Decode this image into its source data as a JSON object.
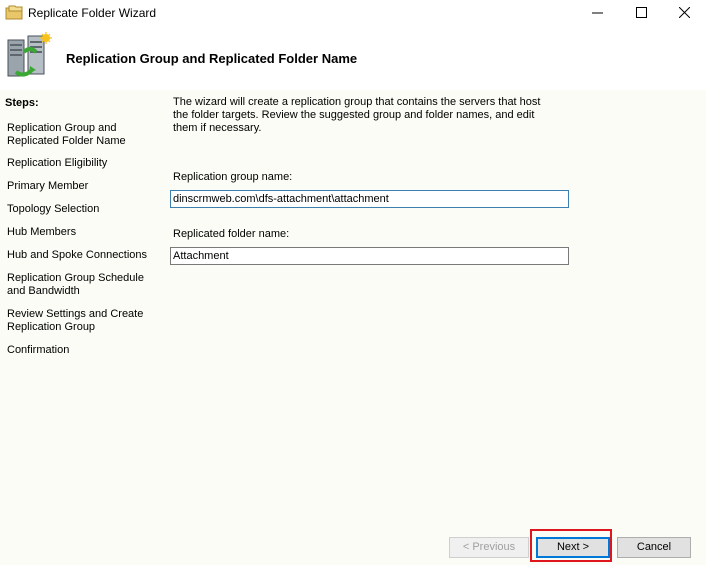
{
  "window": {
    "title": "Replicate Folder Wizard"
  },
  "header": {
    "title": "Replication Group and Replicated Folder Name"
  },
  "steps": {
    "heading": "Steps:",
    "items": [
      "Replication Group and Replicated Folder Name",
      "Replication Eligibility",
      "Primary Member",
      "Topology Selection",
      "Hub Members",
      "Hub and Spoke Connections",
      "Replication Group Schedule and Bandwidth",
      "Review Settings and Create Replication Group",
      "Confirmation"
    ]
  },
  "main": {
    "intro": "The wizard will create a replication group that contains the servers that host the folder targets. Review the suggested group and folder names, and edit them if necessary.",
    "group_label": "Replication group name:",
    "group_value": "dinscrmweb.com\\dfs-attachment\\attachment",
    "folder_label": "Replicated folder name:",
    "folder_value": "Attachment"
  },
  "buttons": {
    "previous": "< Previous",
    "next": "Next >",
    "cancel": "Cancel"
  },
  "colors": {
    "content_bg": "#fcfcf6",
    "highlight": "#e0161e",
    "focus_border": "#3c7fb1"
  }
}
